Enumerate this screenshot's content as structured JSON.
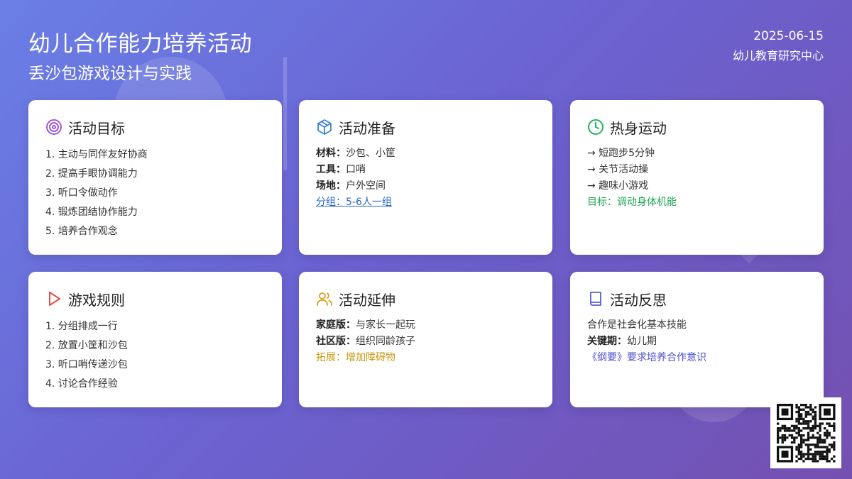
{
  "header": {
    "title": "幼儿合作能力培养活动",
    "subtitle": "丢沙包游戏设计与实践",
    "date": "2025-06-15",
    "org": "幼儿教育研究中心"
  },
  "cards": {
    "goals": {
      "title": "活动目标",
      "icon": "target-icon",
      "items": [
        "1. 主动与同伴友好协商",
        "2. 提高手眼协调能力",
        "3. 听口令做动作",
        "4. 锻炼团结协作能力",
        "5. 培养合作观念"
      ]
    },
    "prep": {
      "title": "活动准备",
      "icon": "box-icon",
      "rows": [
        {
          "key": "材料：",
          "value": "沙包、小筐"
        },
        {
          "key": "工具：",
          "value": "口哨"
        },
        {
          "key": "场地：",
          "value": "户外空间"
        }
      ],
      "link": "分组：5-6人一组"
    },
    "warmup": {
      "title": "热身运动",
      "icon": "clock-icon",
      "items": [
        "→ 短跑步5分钟",
        "→ 关节活动操",
        "→ 趣味小游戏"
      ],
      "goal": "目标：调动身体机能"
    },
    "rules": {
      "title": "游戏规则",
      "icon": "play-icon",
      "items": [
        "1. 分组排成一行",
        "2. 放置小筐和沙包",
        "3. 听口哨传递沙包",
        "4. 讨论合作经验"
      ]
    },
    "extension": {
      "title": "活动延伸",
      "icon": "users-icon",
      "rows": [
        {
          "key": "家庭版：",
          "value": "与家长一起玩"
        },
        {
          "key": "社区版：",
          "value": "组织同龄孩子"
        }
      ],
      "note": "拓展：增加障碍物"
    },
    "reflection": {
      "title": "活动反思",
      "icon": "book-icon",
      "line1": "合作是社会化基本技能",
      "row": {
        "key": "关键期：",
        "value": "幼儿期"
      },
      "note": "《纲要》要求培养合作意识"
    }
  },
  "colors": {
    "bg_start": "#6a7fe6",
    "bg_end": "#7450b0",
    "purple_icon": "#a259d9",
    "blue_icon": "#3b82d6",
    "green_icon": "#22b35e",
    "red_icon": "#e0504a",
    "gold_icon": "#d4a017",
    "indigo_icon": "#5b5fd0"
  },
  "qr": {
    "icon": "qr-code-icon"
  }
}
